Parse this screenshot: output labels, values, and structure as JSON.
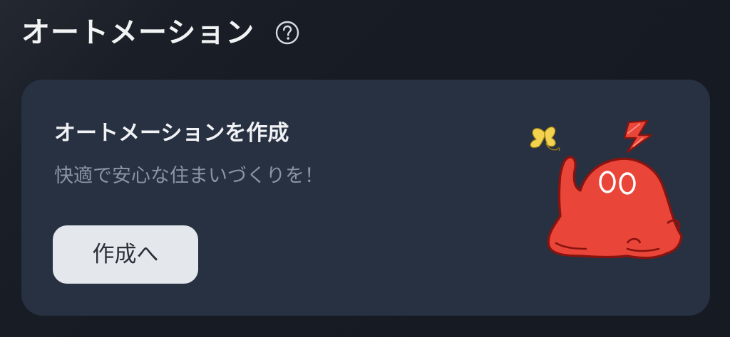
{
  "header": {
    "title": "オートメーション",
    "help_icon": "question-circle-icon"
  },
  "card": {
    "title": "オートメーションを作成",
    "subtitle": "快適で安心な住まいづくりを！",
    "button_label": "作成へ",
    "illustration": "red-mascot-with-butterfly"
  },
  "colors": {
    "background": "#181c24",
    "card": "#283141",
    "button": "#e4e7ec",
    "mascot_red": "#e94639",
    "butterfly_yellow": "#f2d24e"
  }
}
